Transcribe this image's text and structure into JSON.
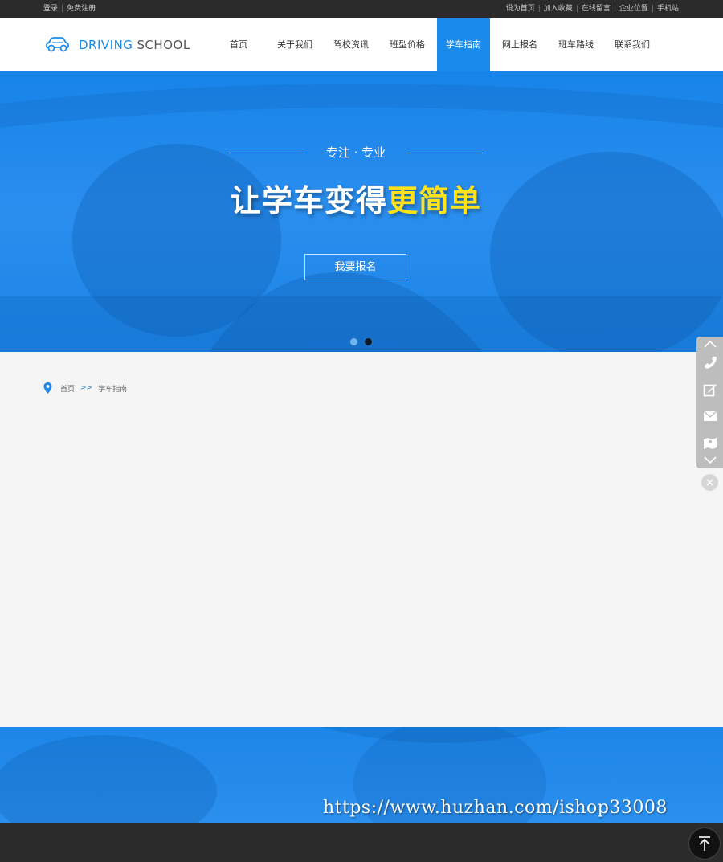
{
  "topbar": {
    "left_links": [
      "登录",
      "免费注册"
    ],
    "right_links": [
      "设为首页",
      "加入收藏",
      "在线留言",
      "企业位置",
      "手机站"
    ]
  },
  "logo": {
    "part1": "DRIVING",
    "part2": "SCHOOL",
    "icon": "car-icon"
  },
  "nav": {
    "items": [
      "首页",
      "关于我们",
      "驾校资讯",
      "班型价格",
      "学车指南",
      "网上报名",
      "班车路线",
      "联系我们"
    ],
    "active": "学车指南"
  },
  "banner": {
    "tagline": "专注 · 专业",
    "headline_main": "让学车变得",
    "headline_highlight": "更简单",
    "cta": "我要报名",
    "slides": 2
  },
  "breadcrumb": {
    "home": "首页",
    "separator": ">>",
    "current": "学车指南"
  },
  "side_tools": [
    "chevron-up-icon",
    "phone-icon",
    "edit-icon",
    "mail-icon",
    "map-icon",
    "chevron-down-icon"
  ],
  "watermark": "https://www.huzhan.com/ishop33008",
  "colors": {
    "brand": "#1a8bea",
    "dark": "#2b2b2b",
    "highlight": "#ffe21a",
    "background": "#f5f5f5"
  }
}
